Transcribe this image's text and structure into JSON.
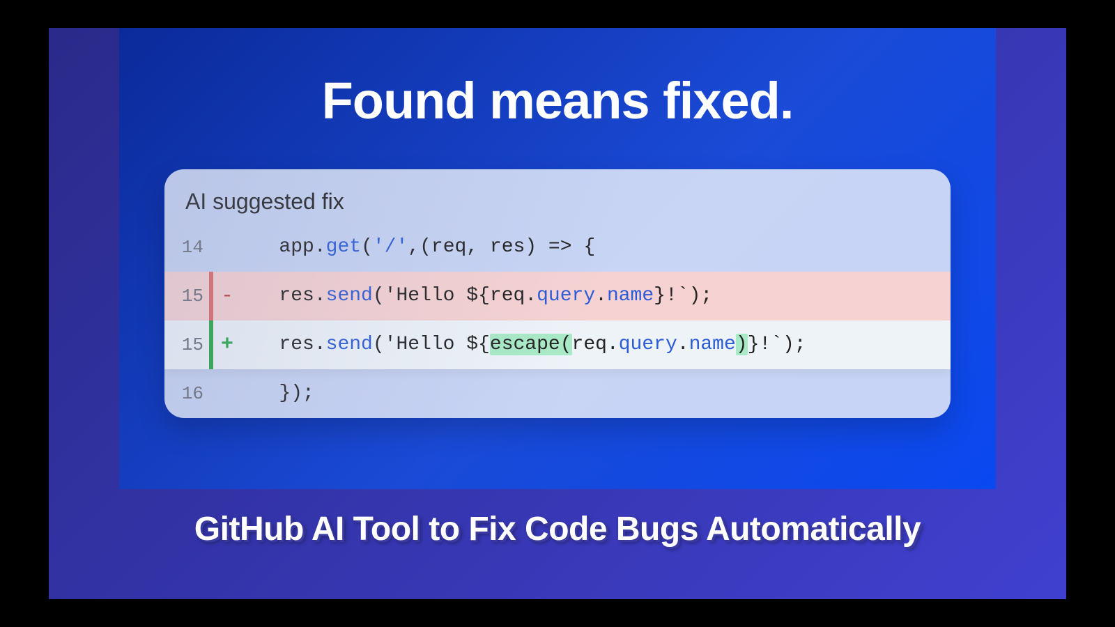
{
  "headline": "Found means fixed.",
  "card_title": "AI suggested fix",
  "caption": "GitHub AI Tool to Fix Code Bugs Automatically",
  "code": {
    "line1_no": "14",
    "line1_p1": "app.",
    "line1_p2": "get",
    "line1_p3": "(",
    "line1_p4": "'/'",
    "line1_p5": ",(req, res) => {",
    "removed_no": "15",
    "removed_sign": "-",
    "removed_p1": "res.",
    "removed_p2": "send",
    "removed_p3": "('Hello ${req.",
    "removed_p4": "query",
    "removed_p5": ".",
    "removed_p6": "name",
    "removed_p7": "}!`);",
    "added_no": "15",
    "added_sign": "+",
    "added_p1": "res.",
    "added_p2": "send",
    "added_p3": "('Hello ${",
    "added_p4": "escape(",
    "added_p5": "req.",
    "added_p6": "query",
    "added_p7": ".",
    "added_p8": "name",
    "added_p9": ")",
    "added_p10": "}!`);",
    "line4_no": "16",
    "line4_p1": "});"
  }
}
